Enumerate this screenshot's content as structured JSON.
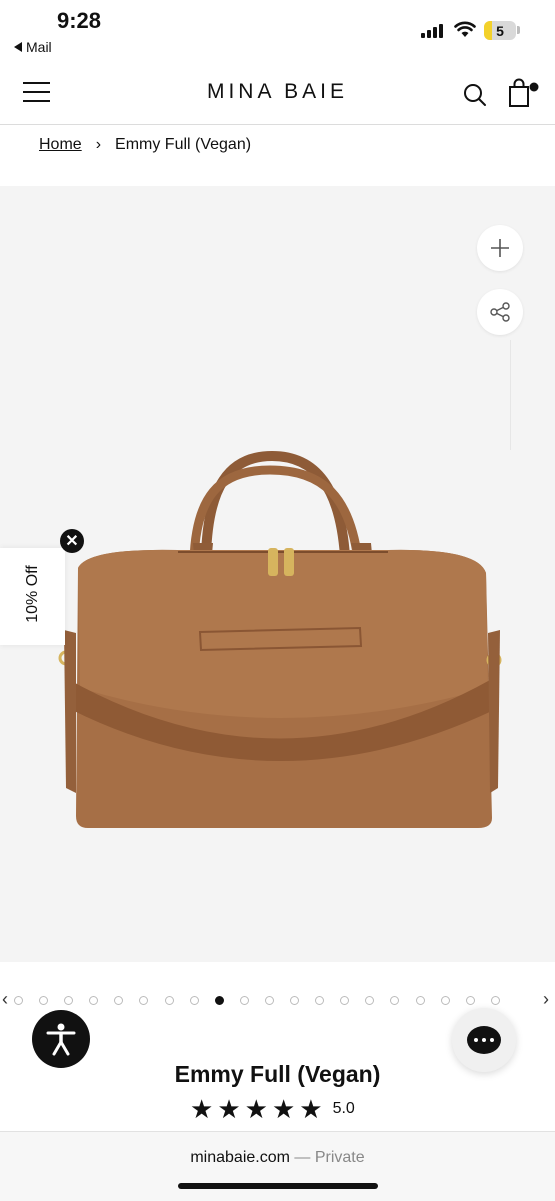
{
  "status_bar": {
    "time": "9:28",
    "back_label": "Mail",
    "battery": "5"
  },
  "header": {
    "brand": "MINA BAIE"
  },
  "breadcrumb": {
    "home": "Home",
    "current": "Emmy Full (Vegan)"
  },
  "gallery": {
    "total_slides": 20,
    "active_slide_index": 8
  },
  "discount_tab": {
    "label": "10% Off"
  },
  "product": {
    "title": "Emmy Full (Vegan)",
    "rating_value": "5.0",
    "stars": 5,
    "bag_color": "#a66f46"
  },
  "browser": {
    "domain": "minabaie.com",
    "private_label": "— Private"
  },
  "icons": [
    "menu-icon",
    "search-icon",
    "cart-icon",
    "plus-icon",
    "share-icon",
    "close-icon",
    "accessibility-icon",
    "chat-icon",
    "chevron-left-icon",
    "chevron-right-icon"
  ]
}
